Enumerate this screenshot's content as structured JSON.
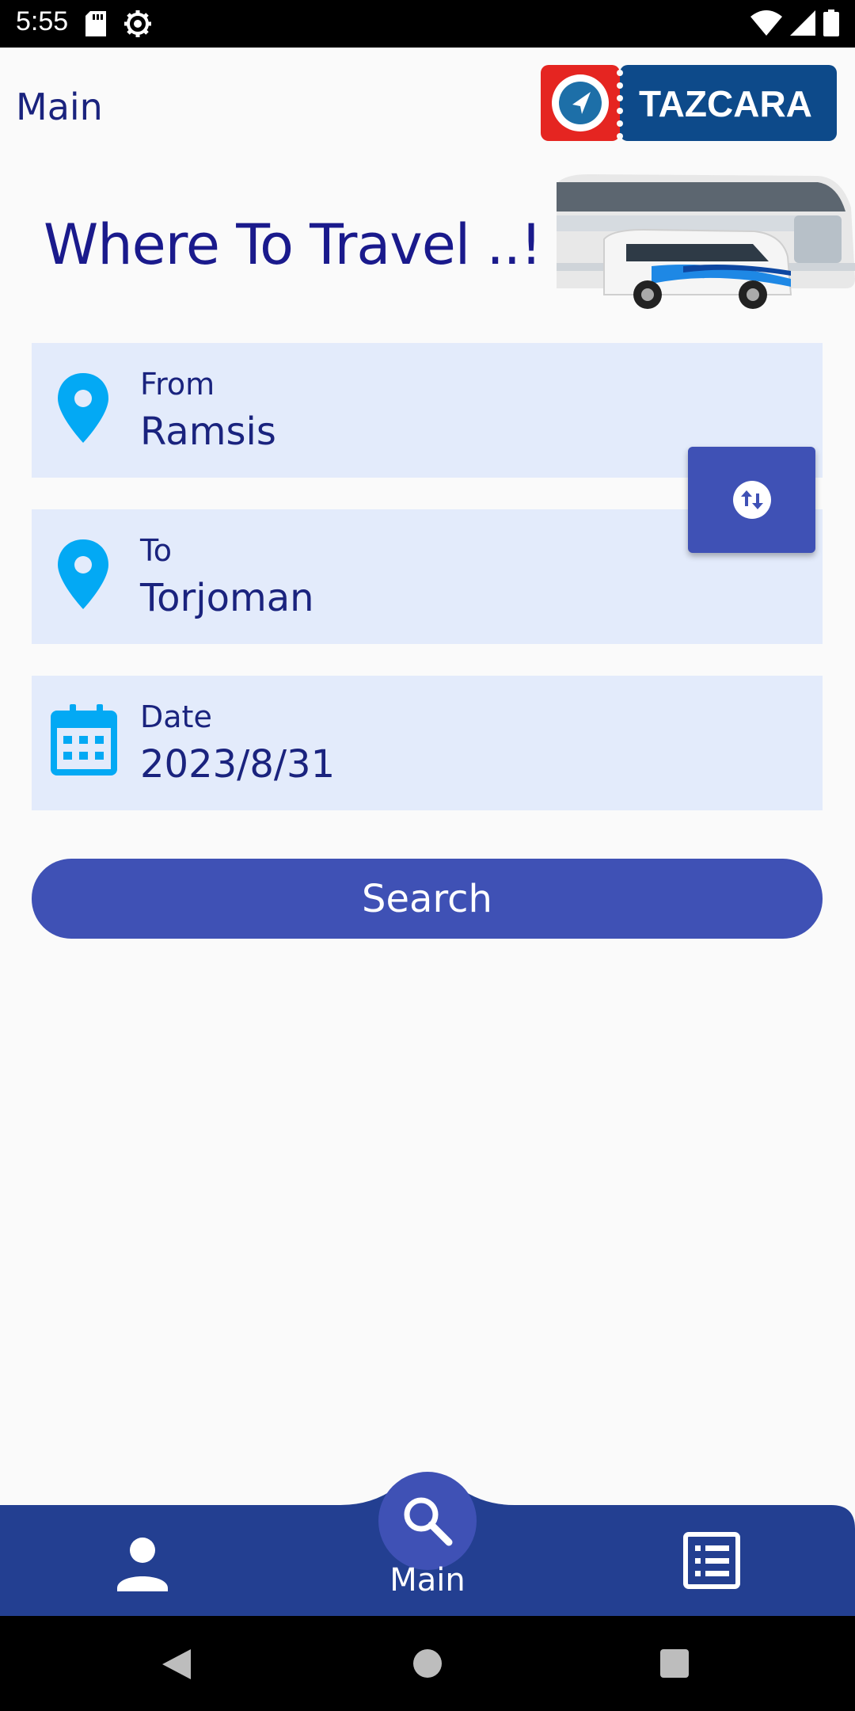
{
  "status_bar": {
    "time": "5:55"
  },
  "header": {
    "title": "Main",
    "logo_text": "TAZCARA"
  },
  "hero": {
    "heading": "Where To Travel ..!"
  },
  "form": {
    "from": {
      "label": "From",
      "value": "Ramsis",
      "icon": "location-pin-icon"
    },
    "to": {
      "label": "To",
      "value": "Torjoman",
      "icon": "location-pin-icon"
    },
    "date": {
      "label": "Date",
      "value": "2023/8/31",
      "icon": "calendar-icon"
    },
    "swap_icon": "swap-vertical-icon",
    "search_label": "Search"
  },
  "bottom_nav": {
    "items": [
      {
        "name": "profile",
        "icon": "person-icon"
      },
      {
        "name": "main",
        "icon": "search-icon",
        "label": "Main"
      },
      {
        "name": "bookings",
        "icon": "list-icon"
      }
    ]
  },
  "colors": {
    "primary": "#3f51b5",
    "nav": "#233f91",
    "field_bg": "#e3ebfb",
    "text_dark": "#1a237e",
    "pin": "#03a9f4"
  }
}
